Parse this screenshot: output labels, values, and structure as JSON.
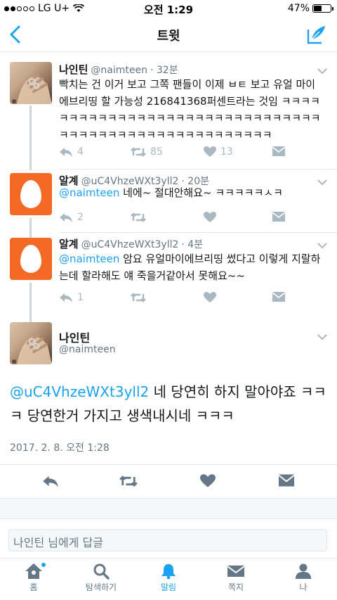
{
  "status_bar": {
    "carrier": "LG U+",
    "time": "오전 1:29",
    "battery": "47%",
    "battery_level": 0.47
  },
  "nav": {
    "title": "트윗"
  },
  "thread": [
    {
      "name": "나인틴",
      "handle": "@naimteen",
      "time": "· 32분",
      "text": "빡치는 건 이거 보고 그쪽 팬들이 이제 ㅂㅌ 보고 유얼 마이 에브리띵 할 가능성 216841368퍼센트라는 것임 ㅋㅋㅋㅋㅋㅋㅋㅋㅋㅋㅋㅋㅋㅋㅋㅋㅋㅋㅋㅋㅋㅋㅋㅋㅋㅋㅋㅋㅋㅋㅋㅋㅋㅋㅋㅋㅋㅋㅋㅋㅋㅋㅋㅋㅋㅋㅋㅋㅋㅋㅋㅋㅋ",
      "replies": "4",
      "retweets": "85",
      "likes": "13"
    },
    {
      "name": "알계",
      "handle": "@uC4VhzeWXt3yll2",
      "time": "· 20분",
      "mention": "@naimteen",
      "text": " 네에~ 절대안해요~ ㅋㅋㅋㅋㅋㅅㅋ",
      "replies": "2"
    },
    {
      "name": "알계",
      "handle": "@uC4VhzeWXt3yll2",
      "time": "· 4분",
      "mention": "@naimteen",
      "text": " 암요 유얼마이에브리띵 썼다고 이렇게 지랄하는데 할라해도 얘 죽을거같아서 못해요~~",
      "replies": "1"
    }
  ],
  "focus": {
    "name": "나인틴",
    "handle": "@naimteen",
    "mention": "@uC4VhzeWXt3yll2",
    "text": " 네 당연히 하지 말아야죠 ㅋㅋㅋ 당연한거 가지고 생색내시네 ㅋㅋㅋ",
    "timestamp": "2017. 2. 8. 오전 1:28"
  },
  "reply_box": {
    "placeholder": "나인틴 님에게 답글"
  },
  "tabs": [
    {
      "label": "홈",
      "icon": "home-icon"
    },
    {
      "label": "탐색하기",
      "icon": "search-icon"
    },
    {
      "label": "알림",
      "icon": "bell-icon"
    },
    {
      "label": "쪽지",
      "icon": "envelope-icon"
    },
    {
      "label": "나",
      "icon": "person-icon"
    }
  ],
  "colors": {
    "accent": "#1da1f2",
    "egg_avatar": "#f46a25",
    "icon_gray": "#aab8c2"
  }
}
